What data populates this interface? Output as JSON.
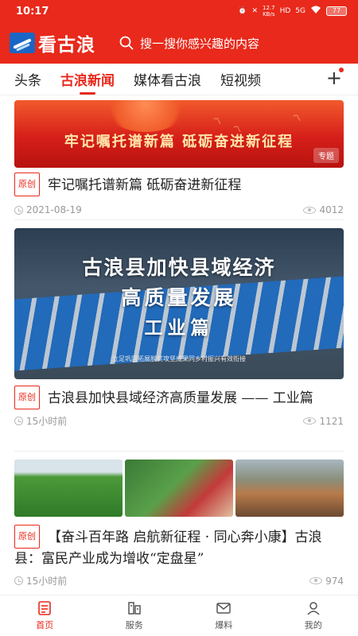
{
  "status_bar": {
    "time": "10:17",
    "net_speed_value": "12.7",
    "net_speed_unit": "KB/s",
    "network_hd": "HD",
    "network_type": "5G",
    "battery": "77"
  },
  "header": {
    "app_name": "看古浪",
    "search_placeholder": "搜一搜你感兴趣的内容"
  },
  "tabs": {
    "items": [
      "头条",
      "古浪新闻",
      "媒体看古浪",
      "短视频"
    ],
    "active_index": 1,
    "add_label": "+"
  },
  "feed": {
    "items": [
      {
        "banner_text": "牢记嘱托谱新篇   砥砺奋进新征程",
        "tag": "专题",
        "badge": "原创",
        "title": "牢记嘱托谱新篇   砥砺奋进新征程",
        "time": "2021-08-19",
        "views": "4012"
      },
      {
        "banner_line1": "古浪县加快县域经济",
        "banner_line2": "高质量发展",
        "banner_line3": "工业篇",
        "banner_caption": "立足巩固拓展脱贫攻坚成果同乡村振兴有效衔接",
        "badge": "原创",
        "title": "古浪县加快县域经济高质量发展 —— 工业篇",
        "time": "15小时前",
        "views": "1121"
      },
      {
        "badge": "原创",
        "title": "【奋斗百年路 启航新征程 · 同心奔小康】古浪县：富民产业成为增收“定盘星”",
        "time": "15小时前",
        "views": "974"
      }
    ]
  },
  "bottom_nav": {
    "items": [
      "首页",
      "服务",
      "爆料",
      "我的"
    ],
    "active_index": 0
  },
  "colors": {
    "brand_red": "#e8291b"
  }
}
